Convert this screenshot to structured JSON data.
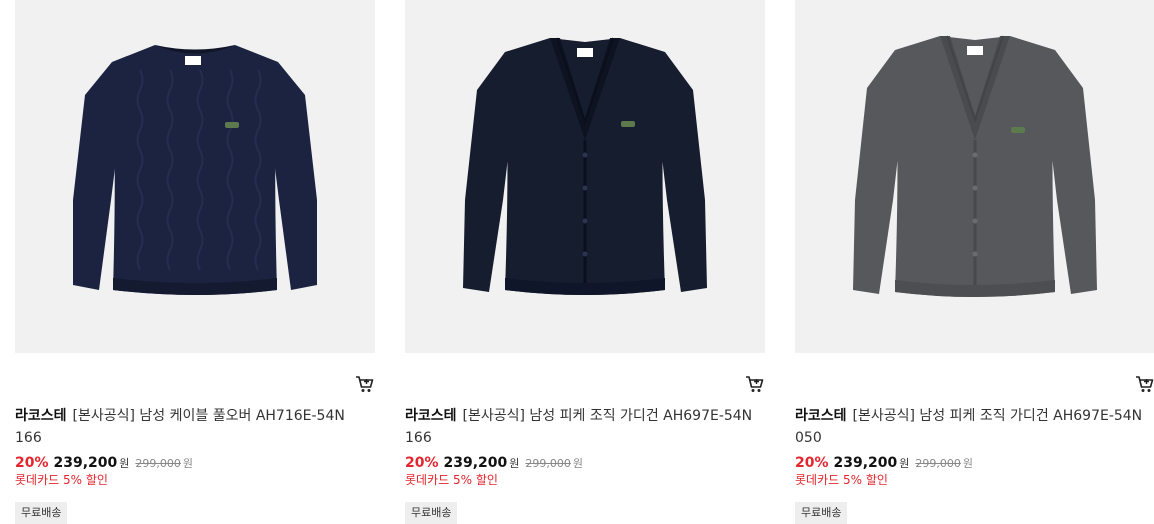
{
  "products": [
    {
      "brand": "라코스테",
      "name": "[본사공식] 남성 케이블 풀오버 AH716E-54N 166",
      "discount": "20%",
      "price": "239,200",
      "price_unit": "원",
      "original_price": "299,000",
      "original_unit": "원",
      "card_promo": "롯데카드 5% 할인",
      "shipping_badge": "무료배송",
      "garment_color": "#1b2340"
    },
    {
      "brand": "라코스테",
      "name": "[본사공식] 남성 피케 조직 가디건 AH697E-54N 166",
      "discount": "20%",
      "price": "239,200",
      "price_unit": "원",
      "original_price": "299,000",
      "original_unit": "원",
      "card_promo": "롯데카드 5% 할인",
      "shipping_badge": "무료배송",
      "garment_color": "#161d2f"
    },
    {
      "brand": "라코스테",
      "name": "[본사공식] 남성 피케 조직 가디건 AH697E-54N 050",
      "discount": "20%",
      "price": "239,200",
      "price_unit": "원",
      "original_price": "299,000",
      "original_unit": "원",
      "card_promo": "롯데카드 5% 할인",
      "shipping_badge": "무료배송",
      "garment_color": "#57585c"
    }
  ],
  "icons": {
    "cart": "shopping-cart-icon",
    "logo": "crocodile-logo"
  },
  "colors": {
    "discount": "#e3262d",
    "image_background": "#f1f1f1",
    "badge_background": "#eeeeee"
  }
}
